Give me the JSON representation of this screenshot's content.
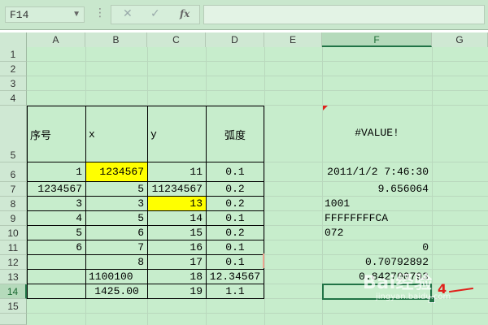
{
  "formula_bar": {
    "name_box": "F14",
    "cancel_icon": "✕",
    "enter_icon": "✓",
    "fx_label": "fx",
    "formula": ""
  },
  "columns": [
    "A",
    "B",
    "C",
    "D",
    "E",
    "F",
    "G"
  ],
  "selected_column": "F",
  "rows": [
    "1",
    "2",
    "3",
    "4",
    "5",
    "6",
    "7",
    "8",
    "9",
    "10",
    "11",
    "12",
    "13",
    "14",
    "15"
  ],
  "selected_row": "14",
  "header_row": {
    "seq": "序号",
    "x": "x",
    "y": "y",
    "radian": "弧度",
    "f_value": "#VALUE!"
  },
  "data_rows": [
    {
      "a": "1",
      "b": "1234567",
      "c": "11",
      "d": "0.1",
      "f": "2011/1/2 7:46:30"
    },
    {
      "a": "1234567",
      "b": "5",
      "c": "11234567",
      "d": "0.2",
      "f": "9.656064"
    },
    {
      "a": "3",
      "b": "3",
      "c": "13",
      "d": "0.2",
      "f": "1001"
    },
    {
      "a": "4",
      "b": "5",
      "c": "14",
      "d": "0.1",
      "f": "FFFFFFFFCA"
    },
    {
      "a": "5",
      "b": "6",
      "c": "15",
      "d": "0.2",
      "f": "072"
    },
    {
      "a": "6",
      "b": "7",
      "c": "16",
      "d": "0.1",
      "f": "0"
    },
    {
      "a": "",
      "b": "8",
      "c": "17",
      "d": "0.1",
      "f": "0.70792892"
    },
    {
      "a": "",
      "b": "1100100",
      "c": "18",
      "d": "12.34567",
      "f": "0.842700793"
    },
    {
      "a": "",
      "b": "1425.00",
      "c": "19",
      "d": "1.1",
      "f": ""
    }
  ],
  "annotation": {
    "number": "4"
  },
  "watermark": {
    "main": "Bai经验",
    "sub": "jingyan.baidu.com"
  },
  "colors": {
    "grid_bg": "#c7edcc",
    "highlight": "#ffff00",
    "selection": "#217346",
    "annotation": "#e0211b"
  }
}
